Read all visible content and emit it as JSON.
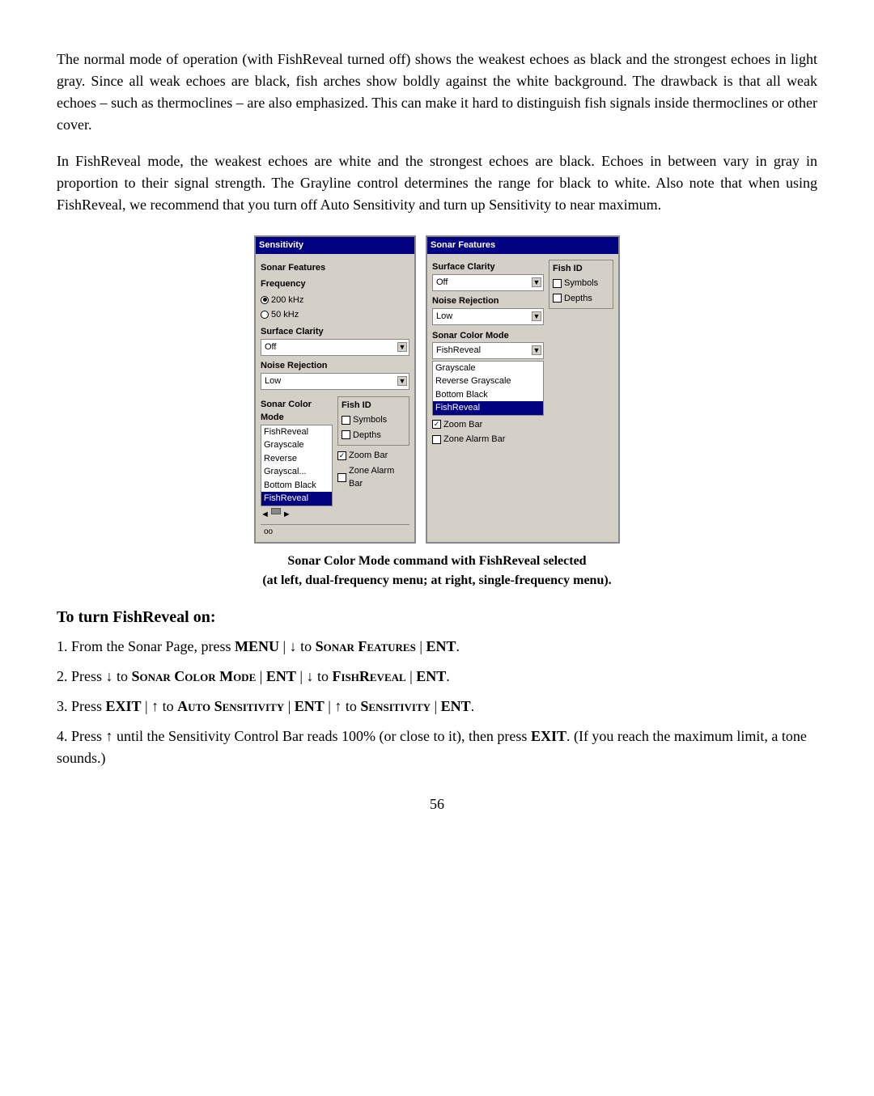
{
  "paragraphs": {
    "p1": "The normal mode of operation (with FishReveal turned off) shows the weakest echoes as black and the strongest echoes in light gray. Since all weak echoes are black, fish arches show boldly against the white background. The drawback is that all weak echoes – such as thermoclines – are also emphasized. This can make it hard to distinguish fish signals inside thermoclines or other cover.",
    "p2": "In FishReveal mode, the weakest echoes are white and the strongest echoes are black. Echoes in between vary in gray in proportion to their signal strength. The Grayline control determines the range for black to white. Also note that when using FishReveal, we recommend that you turn off Auto Sensitivity and turn up Sensitivity to near maximum."
  },
  "left_window": {
    "title": "Sensitivity",
    "sonar_features_label": "Sonar Features",
    "frequency_label": "Frequency",
    "freq_200_label": "200 kHz",
    "freq_50_label": "50 kHz",
    "surface_clarity_label": "Surface Clarity",
    "surface_clarity_value": "Off",
    "noise_rejection_label": "Noise Rejection",
    "noise_rejection_value": "Low",
    "sonar_color_mode_label": "Sonar Color Mode",
    "fish_id_label": "Fish ID",
    "symbols_label": "Symbols",
    "depths_label": "Depths",
    "list_items": [
      "FishReveal",
      "Grayscale",
      "Reverse Grayscal...",
      "Bottom Black",
      "FishReveal"
    ],
    "zoom_bar_label": "Zoom Bar",
    "zone_alarm_bar_label": "Zone Alarm Bar",
    "bottom_value": "oo"
  },
  "right_window": {
    "title": "Sonar Features",
    "surface_clarity_label": "Surface Clarity",
    "fish_id_label": "Fish ID",
    "surface_clarity_value": "Off",
    "noise_rejection_label": "Noise Rejection",
    "noise_rejection_value": "Low",
    "symbols_label": "Symbols",
    "depths_label": "Depths",
    "sonar_color_mode_label": "Sonar Color Mode",
    "sonar_color_value": "FishReveal",
    "list_items": [
      "Grayscale",
      "Reverse Grayscale",
      "Bottom Black",
      "FishReveal"
    ],
    "zoom_bar_label": "Zoom Bar",
    "zone_alarm_bar_label": "Zone Alarm Bar"
  },
  "caption": {
    "line1": "Sonar Color Mode command with FishReveal selected",
    "line2": "(at left, dual-frequency menu; at right, single-frequency menu)."
  },
  "heading": "To turn FishReveal on:",
  "steps": [
    {
      "num": "1.",
      "text_before": "From the Sonar Page, press ",
      "bold1": "MENU",
      "sep1": " | ↓ to ",
      "sc1": "Sonar Features",
      "sep2": " | ",
      "bold2": "ENT",
      "text_after": "."
    },
    {
      "num": "2.",
      "text_before": "Press ↓ to ",
      "sc1": "Sonar Color Mode",
      "sep1": " | ",
      "bold1": "ENT",
      "sep2": " | ↓ to ",
      "sc2": "FishReveal",
      "sep3": " | ",
      "bold2": "ENT",
      "text_after": "."
    },
    {
      "num": "3.",
      "text_before": "Press ",
      "bold1": "EXIT",
      "sep1": " | ↑ to ",
      "sc1": "Auto Sensitivity",
      "sep2": " | ",
      "bold2": "ENT",
      "sep3": " | ↑ to ",
      "sc2": "Sensitivity",
      "sep4": " | ",
      "bold3": "ENT",
      "text_after": "."
    },
    {
      "num": "4.",
      "text_before": "Press ↑ until the Sensitivity Control Bar reads 100% (or close to it), then press ",
      "bold1": "EXIT",
      "text_after": ". (If you reach the maximum limit, a tone sounds.)"
    }
  ],
  "page_number": "56"
}
